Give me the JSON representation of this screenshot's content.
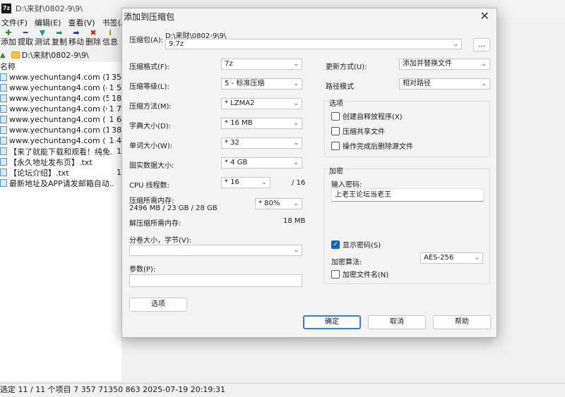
{
  "bg": {
    "logo": "7z",
    "title": "D:\\来财\\0802-9\\9\\",
    "menu": [
      "文件(F)",
      "编辑(E)",
      "查看(V)",
      "书签(A)"
    ],
    "toolbar": [
      {
        "glyph": "✚",
        "label": "添加",
        "color": "#2e8b2e"
      },
      {
        "glyph": "━",
        "label": "提取",
        "color": "#1f3a93"
      },
      {
        "glyph": "▼",
        "label": "测试",
        "color": "#1a9b9b"
      },
      {
        "glyph": "➡",
        "label": "复制",
        "color": "#1a8b5a"
      },
      {
        "glyph": "➡",
        "label": "移动",
        "color": "#1f3a93"
      },
      {
        "glyph": "✖",
        "label": "删除",
        "color": "#cc1f1f"
      },
      {
        "glyph": "i",
        "label": "信息",
        "color": "#b8860b"
      }
    ],
    "path": "D:\\来财\\0802-9\\9\\",
    "column_name": "名称",
    "files": [
      {
        "name": "www.yechuntang4.com (1)....",
        "size": "35"
      },
      {
        "name": "www.yechuntang4.com (4)....",
        "size": "1 5"
      },
      {
        "name": "www.yechuntang4.com (5)....",
        "size": "18"
      },
      {
        "name": "www.yechuntang4.com (6)....",
        "size": "1 7"
      },
      {
        "name": "www.yechuntang4.com (10...",
        "size": "1 6"
      },
      {
        "name": "www.yechuntang4.com (11...",
        "size": "38"
      },
      {
        "name": "www.yechuntang4.com (13...",
        "size": "1 4"
      },
      {
        "name": "【来了就能下载和观看！纯免...",
        "size": "1"
      },
      {
        "name": "【永久地址发布页】.txt",
        "size": ""
      },
      {
        "name": "【论坛介绍】.txt",
        "size": "1"
      },
      {
        "name": "最新地址及APP请发邮箱自动...",
        "size": ""
      }
    ],
    "status": "选定 11 / 11 个项目 7 357 71350 863 2025-07-19 20:19:31"
  },
  "dialog": {
    "title": "添加到压缩包",
    "close_glyph": "✕",
    "archive_label": "压缩包(A):",
    "archive_dir": "D:\\来财\\0802-9\\9\\",
    "archive_name": "9.7z",
    "browse_label": "...",
    "format_label": "压缩格式(F):",
    "format_value": "7z",
    "level_label": "压缩等级(L):",
    "level_value": "5 - 标准压缩",
    "method_label": "压缩方法(M):",
    "method_value": "*  LZMA2",
    "dict_label": "字典大小(D):",
    "dict_value": "*  16 MB",
    "word_label": "单词大小(W):",
    "word_value": "*  32",
    "solid_label": "固实数据大小:",
    "solid_value": "*  4 GB",
    "cpu_label": "CPU 线程数:",
    "cpu_value": "*  16",
    "cpu_max": "/ 16",
    "mem_comp_label": "压缩所需内存:",
    "mem_comp_value": "2496 MB / 23 GB / 28 GB",
    "mem_comp_pct": "*  80%",
    "mem_decomp_label": "解压缩所需内存:",
    "mem_decomp_value": "18 MB",
    "split_label": "分卷大小，字节(V):",
    "params_label": "参数(P):",
    "options_btn": "选项",
    "update_label": "更新方式(U):",
    "update_value": "添加并替换文件",
    "pathmode_label": "路径模式",
    "pathmode_value": "相对路径",
    "options_group": "选项",
    "opt_sfx": "创建自释放程序(X)",
    "opt_shared": "压缩共享文件",
    "opt_delete": "操作完成后删除源文件",
    "enc_group": "加密",
    "pwd_label": "输入密码:",
    "pwd_value": "上老王论坛当老王",
    "show_pwd": "显示密码(S)",
    "enc_method_label": "加密算法:",
    "enc_method_value": "AES-256",
    "enc_names": "加密文件名(N)",
    "ok": "确定",
    "cancel": "取消",
    "help": "帮助"
  },
  "colors": {
    "accent": "#1565c0",
    "folder": "#f2c14e"
  }
}
